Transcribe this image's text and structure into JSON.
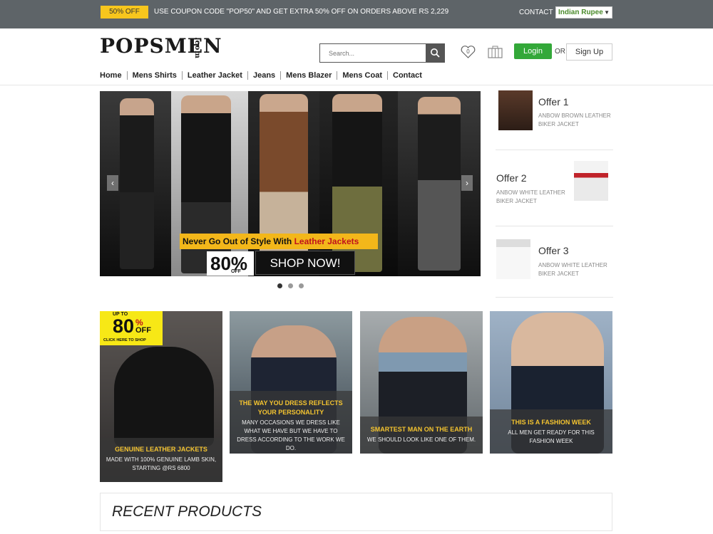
{
  "topbar": {
    "badge": "50% OFF",
    "coupon_text": "USE COUPON CODE \"POP50\" AND GET EXTRA 50% OFF ON ORDERS ABOVE RS 2,229",
    "contact": "CONTACT",
    "currency": "Indian Rupee"
  },
  "header": {
    "logo_text": "POPSMEN",
    "logo_domain": ".com",
    "search_placeholder": "Search...",
    "wishlist_count": "0",
    "login": "Login",
    "or": "OR",
    "signup": "Sign Up"
  },
  "nav": [
    "Home",
    "Mens Shirts",
    "Leather Jacket",
    "Jeans",
    "Mens Blazer",
    "Mens Coat",
    "Contact"
  ],
  "hero": {
    "tagline_prefix": "Never Go Out of Style With ",
    "tagline_highlight": "Leather Jackets",
    "percent": "80%",
    "percent_sub": "OFF",
    "cta": "SHOP NOW!",
    "active_slide": 1,
    "slide_count": 3
  },
  "offers": [
    {
      "title": "Offer 1",
      "desc": "ANBOW BROWN LEATHER BIKER JACKET"
    },
    {
      "title": "Offer 2",
      "desc": "ANBOW WHITE LEATHER BIKER JACKET"
    },
    {
      "title": "Offer 3",
      "desc": "ANBOW WHITE LEATHER BIKER JACKET"
    }
  ],
  "promo": {
    "up_to": "UP TO",
    "pct": "80",
    "sym": "%",
    "off": "OFF",
    "click": "CLICK HERE TO SHOP"
  },
  "cards": [
    {
      "title": "GENUINE LEATHER JACKETS",
      "desc": "MADE WITH 100% GENUINE LAMB SKIN, STARTING @RS 6800"
    },
    {
      "title": "THE WAY YOU DRESS REFLECTS YOUR PERSONALITY",
      "desc": "MANY OCCASIONS WE DRESS LIKE WHAT WE HAVE BUT WE HAVE TO DRESS ACCORDING TO THE WORK WE DO."
    },
    {
      "title": "SMARTEST MAN ON THE EARTH",
      "desc": "WE SHOULD LOOK LIKE ONE OF THEM."
    },
    {
      "title": "THIS IS A FASHION WEEK",
      "desc": "ALL MEN GET READY FOR THIS FASHION WEEK"
    }
  ],
  "recent_title": "RECENT PRODUCTS",
  "colors": {
    "topbar": "#5e6468",
    "badge": "#f7c61d",
    "login": "#33a839",
    "accent_text": "#f4c430"
  }
}
